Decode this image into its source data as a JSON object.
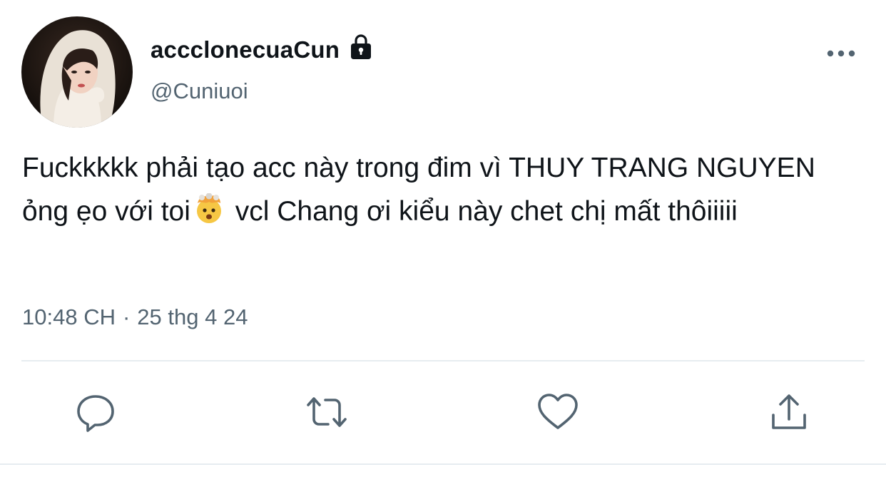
{
  "author": {
    "display_name": "accclonecuaCun",
    "handle": "@Cuniuoi",
    "avatar_icon": "user-avatar-photo",
    "protected_icon": "lock-icon"
  },
  "tweet": {
    "text_part1": "Fuckkkkk phải tạo acc này trong đim vì THUY TRANG NGUYEN ỏng ẹo với toi",
    "emoji_name": "exploding-head-emoji",
    "text_part2": " vcl Chang ơi kiểu này chet chị mất thôiiiii",
    "time": "10:48 CH",
    "separator": "·",
    "date": "25 thg 4 24"
  },
  "actions": {
    "reply_icon": "reply-icon",
    "retweet_icon": "retweet-icon",
    "like_icon": "heart-icon",
    "share_icon": "share-icon",
    "more_icon": "more-icon"
  },
  "colors": {
    "text_primary": "#0f1419",
    "text_secondary": "#536471",
    "icon_color": "#536471",
    "divider": "#e6ecf0"
  }
}
